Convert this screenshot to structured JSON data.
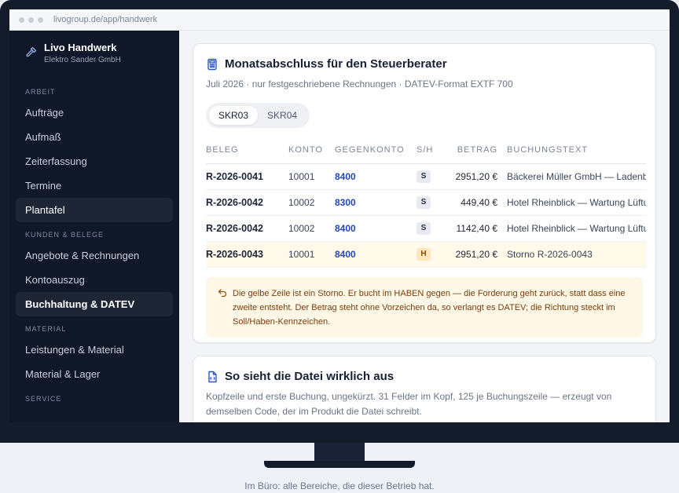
{
  "browser": {
    "url": "livogroup.de/app/handwerk"
  },
  "brand": {
    "name": "Livo Handwerk",
    "company": "Elektro Sander GmbH",
    "icon": "hammer-icon"
  },
  "sidebar": {
    "sections": [
      {
        "title": "ARBEIT",
        "items": [
          {
            "label": "Aufträge",
            "active": false
          },
          {
            "label": "Aufmaß",
            "active": false
          },
          {
            "label": "Zeiterfassung",
            "active": false
          },
          {
            "label": "Termine",
            "active": false
          },
          {
            "label": "Plantafel",
            "active": true
          }
        ]
      },
      {
        "title": "KUNDEN & BELEGE",
        "items": [
          {
            "label": "Angebote & Rechnungen",
            "active": false
          },
          {
            "label": "Kontoauszug",
            "active": false
          },
          {
            "label": "Buchhaltung & DATEV",
            "active": true
          }
        ]
      },
      {
        "title": "MATERIAL",
        "items": [
          {
            "label": "Leistungen & Material",
            "active": false
          },
          {
            "label": "Material & Lager",
            "active": false
          }
        ]
      },
      {
        "title": "SERVICE",
        "items": []
      }
    ]
  },
  "card1": {
    "title": "Monatsabschluss für den Steuerberater",
    "subtitle": "Juli 2026 · nur festgeschriebene Rechnungen · DATEV-Format EXTF 700",
    "tabs": [
      "SKR03",
      "SKR04"
    ],
    "selected_tab": "SKR03",
    "table": {
      "headers": [
        "BELEG",
        "KONTO",
        "GEGENKONTO",
        "S/H",
        "BETRAG",
        "BUCHUNGSTEXT"
      ],
      "rows": [
        {
          "beleg": "R-2026-0041",
          "konto": "10001",
          "gegenkonto": "8400",
          "sh": "S",
          "betrag": "2951,20 €",
          "text": "Bäckerei Müller GmbH — Ladenbeleuchtung"
        },
        {
          "beleg": "R-2026-0042",
          "konto": "10002",
          "gegenkonto": "8300",
          "sh": "S",
          "betrag": "449,40 €",
          "text": "Hotel Rheinblick — Wartung Lüftung"
        },
        {
          "beleg": "R-2026-0042",
          "konto": "10002",
          "gegenkonto": "8400",
          "sh": "S",
          "betrag": "1142,40 €",
          "text": "Hotel Rheinblick — Wartung Lüftung"
        },
        {
          "beleg": "R-2026-0043",
          "konto": "10001",
          "gegenkonto": "8400",
          "sh": "H",
          "betrag": "2951,20 €",
          "text": "Storno R-2026-0043",
          "highlight": true
        }
      ]
    },
    "note": "Die gelbe Zeile ist ein Storno. Er bucht im HABEN gegen — die Forderung geht zurück, statt dass eine zweite entsteht. Der Betrag steht ohne Vorzeichen da, so verlangt es DATEV; die Richtung steckt im Soll/Haben-Kennzeichen."
  },
  "card2": {
    "title": "So sieht die Datei wirklich aus",
    "subtitle": "Kopfzeile und erste Buchung, ungekürzt. 31 Felder im Kopf, 125 je Buchungszeile — erzeugt von demselben Code, der im Produkt die Datei schreibt."
  },
  "caption": "Im Büro: alle Bereiche, die dieser Betrieb hat.",
  "colors": {
    "sidebar_bg": "#0f1728",
    "accent": "#2447b8",
    "storno_highlight": "#fff9e9",
    "note_bg": "#fff8e6"
  }
}
